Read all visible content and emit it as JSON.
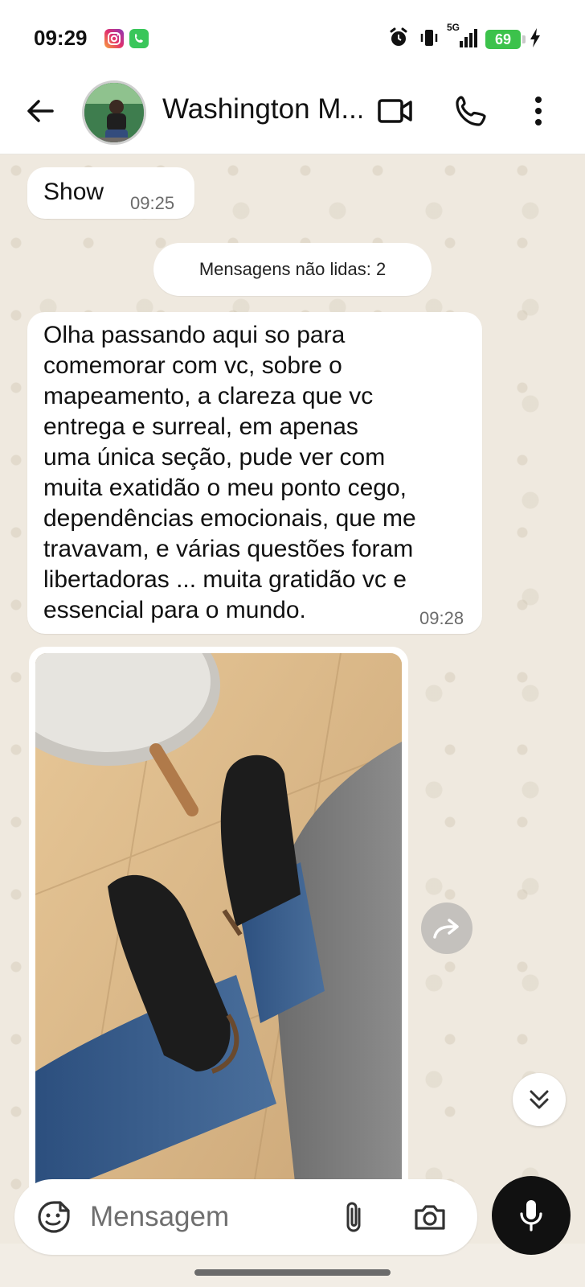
{
  "status_bar": {
    "time": "09:29",
    "network": "5G",
    "battery": "69",
    "app_icons": [
      "instagram-icon",
      "whatsapp-icon"
    ],
    "right_icons": [
      "alarm-icon",
      "vibrate-icon",
      "signal-icon",
      "battery-icon",
      "charging-icon"
    ]
  },
  "header": {
    "contact_name": "Washington M...",
    "icons": [
      "back-arrow-icon",
      "video-call-icon",
      "phone-icon",
      "more-vert-icon"
    ]
  },
  "messages": [
    {
      "type": "text",
      "text": "Show",
      "time": "09:25"
    },
    {
      "type": "system",
      "text": "Mensagens não lidas: 2"
    },
    {
      "type": "text",
      "text": "Olha passando aqui so para\ncomemorar com vc, sobre o\nmapeamento, a clareza que vc\nentrega e surreal, em apenas\numa única seção, pude ver com\nmuita exatidão o meu ponto cego,\ndependências emocionais, que me\ntravavam, e várias questões foram\nlibertadoras ... muita gratidão vc e\nessencial para o mundo.",
      "time": "09:28"
    },
    {
      "type": "image",
      "alt": "photo"
    }
  ],
  "composer": {
    "placeholder": "Mensagem",
    "icons": [
      "sticker-icon",
      "attach-icon",
      "camera-icon",
      "mic-icon"
    ]
  },
  "colors": {
    "header_bg": "#ffffff",
    "chat_bg": "#efe9df",
    "bubble_bg": "#ffffff",
    "battery": "#3cc24b",
    "mic_button": "#111111"
  }
}
